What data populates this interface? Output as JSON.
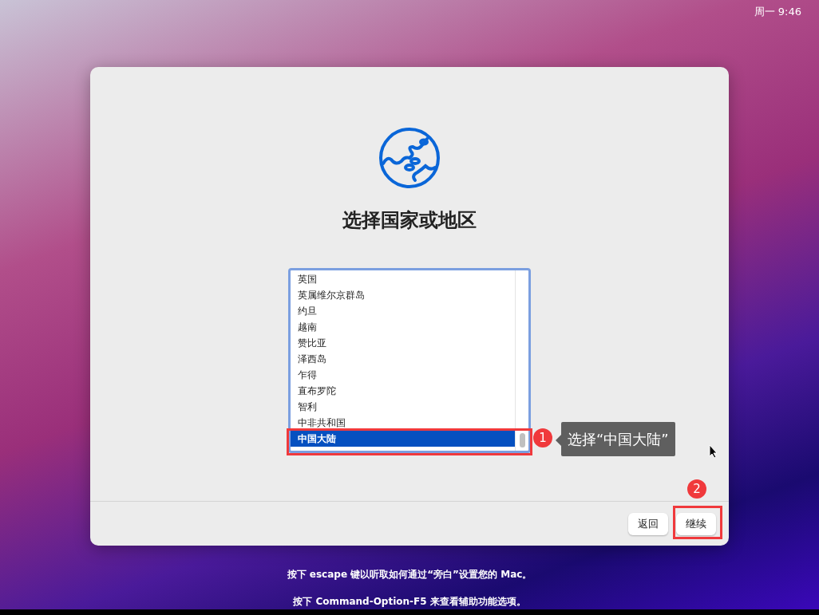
{
  "menu_bar": {
    "clock": "周一 9:46"
  },
  "dialog": {
    "title": "选择国家或地区",
    "list": [
      {
        "label": "英国",
        "selected": false
      },
      {
        "label": "英属维尔京群岛",
        "selected": false
      },
      {
        "label": "约旦",
        "selected": false
      },
      {
        "label": "越南",
        "selected": false
      },
      {
        "label": "赞比亚",
        "selected": false
      },
      {
        "label": "泽西岛",
        "selected": false
      },
      {
        "label": "乍得",
        "selected": false
      },
      {
        "label": "直布罗陀",
        "selected": false
      },
      {
        "label": "智利",
        "selected": false
      },
      {
        "label": "中非共和国",
        "selected": false
      },
      {
        "label": "中国大陆",
        "selected": true
      }
    ],
    "buttons": [
      {
        "label": "返回"
      },
      {
        "label": "继续"
      }
    ]
  },
  "annotations": [
    {
      "number": "1",
      "note": "选择“中国大陆”"
    },
    {
      "number": "2"
    }
  ],
  "hints": [
    "按下 escape 键以听取如何通过“旁白”设置您的 Mac。",
    "按下 Command-Option-F5 来查看辅助功能选项。"
  ]
}
